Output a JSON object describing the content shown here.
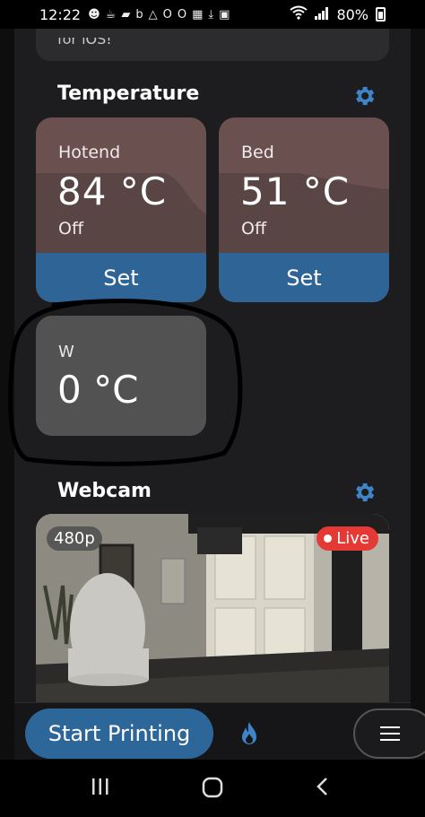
{
  "status_bar": {
    "time": "12:22",
    "battery": "80%",
    "notification_icons": [
      "account-icon",
      "cup-icon",
      "app-icon",
      "bing-icon",
      "drive-icon",
      "opera-icon",
      "opera-icon",
      "gallery-icon",
      "download-icon",
      "sd-card-icon"
    ]
  },
  "previous_card": {
    "text": "for iOS!"
  },
  "temperature": {
    "title": "Temperature",
    "cards": [
      {
        "label": "Hotend",
        "value": "84 °C",
        "state": "Off",
        "button": "Set"
      },
      {
        "label": "Bed",
        "value": "51 °C",
        "state": "Off",
        "button": "Set"
      }
    ],
    "extra": {
      "label": "W",
      "value": "0 °C"
    }
  },
  "webcam": {
    "title": "Webcam",
    "resolution": "480p",
    "live_label": "Live"
  },
  "bottom_bar": {
    "start_label": "Start Printing"
  },
  "colors": {
    "accent_blue": "#2d6699",
    "card_heat": "#5a4545",
    "live_red": "#e53935"
  }
}
